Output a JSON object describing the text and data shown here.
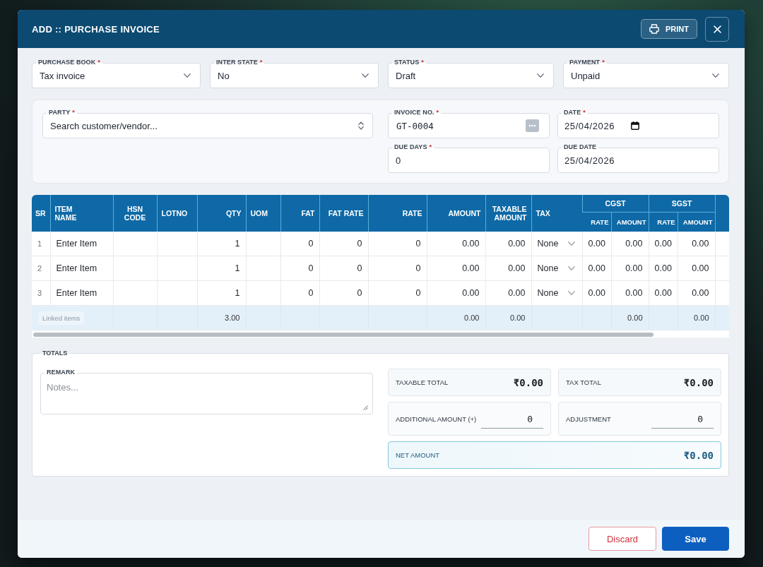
{
  "window": {
    "title": "ADD :: PURCHASE INVOICE",
    "actions": [
      {
        "kind": "print",
        "label": "PRINT"
      },
      {
        "kind": "close"
      }
    ]
  },
  "header_fields": [
    {
      "kind": "select",
      "label": "PURCHASE BOOK",
      "required_mark": "*",
      "value": "Tax invoice"
    },
    {
      "kind": "select",
      "label": "INTER STATE",
      "required_mark": "*",
      "value": "No"
    },
    {
      "kind": "select",
      "label": "STATUS",
      "required_mark": "*",
      "value": "Draft"
    },
    {
      "kind": "select",
      "label": "PAYMENT",
      "required_mark": "*",
      "value": "Unpaid"
    }
  ],
  "party_section": {
    "fields": [
      {
        "kind": "search",
        "label": "PARTY",
        "required_mark": "*",
        "placeholder": "Search customer/vendor..."
      },
      {
        "kind": "code",
        "label": "INVOICE NO.",
        "required_mark": "*",
        "value": "GT-0004"
      },
      {
        "kind": "date",
        "label": "DATE",
        "required_mark": "*",
        "value": "25/04/2026"
      },
      {
        "kind": "number",
        "label": "DUE DAYS",
        "required_mark": "*",
        "value": "0"
      },
      {
        "kind": "text",
        "label": "DUE DATE",
        "value": "25/04/2026"
      }
    ]
  },
  "items_table": {
    "columns": [
      {
        "label": "SR",
        "kind": "index"
      },
      {
        "label": "ITEM\nNAME",
        "kind": "text"
      },
      {
        "label": "HSN\nCODE",
        "kind": "code"
      },
      {
        "label": "LOTNO",
        "kind": "text"
      },
      {
        "label": "QTY",
        "kind": "number"
      },
      {
        "label": "UOM",
        "kind": "text"
      },
      {
        "label": "FAT",
        "kind": "number"
      },
      {
        "label": "FAT RATE",
        "kind": "number"
      },
      {
        "label": "RATE",
        "kind": "number"
      },
      {
        "label": "AMOUNT",
        "kind": "number"
      },
      {
        "label": "TAXABLE\nAMOUNT",
        "kind": "number"
      },
      {
        "label": "TAX",
        "kind": "select"
      },
      {
        "label": "CGST",
        "kind": "group",
        "subcolumns": [
          {
            "label": "RATE",
            "kind": "number"
          },
          {
            "label": "AMOUNT",
            "kind": "number"
          }
        ]
      },
      {
        "label": "SGST",
        "kind": "group",
        "subcolumns": [
          {
            "label": "RATE",
            "kind": "number"
          },
          {
            "label": "AMOUNT",
            "kind": "number"
          }
        ]
      }
    ],
    "rows": [
      {
        "sr": "1",
        "item_name": "Enter Item",
        "qty": "1",
        "fat": "0",
        "fat_rate": "0",
        "rate": "0",
        "amount": "0.00",
        "taxable_amount": "0.00",
        "tax": "None",
        "cgst_rate": "0.00",
        "cgst_amount": "0.00",
        "sgst_rate": "0.00",
        "sgst_amount": "0.00"
      },
      {
        "sr": "2",
        "item_name": "Enter Item",
        "qty": "1",
        "fat": "0",
        "fat_rate": "0",
        "rate": "0",
        "amount": "0.00",
        "taxable_amount": "0.00",
        "tax": "None",
        "cgst_rate": "0.00",
        "cgst_amount": "0.00",
        "sgst_rate": "0.00",
        "sgst_amount": "0.00"
      },
      {
        "sr": "3",
        "item_name": "Enter Item",
        "qty": "1",
        "fat": "0",
        "fat_rate": "0",
        "rate": "0",
        "amount": "0.00",
        "taxable_amount": "0.00",
        "tax": "None",
        "cgst_rate": "0.00",
        "cgst_amount": "0.00",
        "sgst_rate": "0.00",
        "sgst_amount": "0.00"
      }
    ],
    "footer": {
      "linked_items": "Linked items",
      "qty": "3.00",
      "amount": "0.00",
      "taxable_amount": "0.00",
      "cgst_amount": "0.00",
      "sgst_amount": "0.00"
    }
  },
  "totals": {
    "title": "TOTALS",
    "remark": {
      "label": "REMARK",
      "placeholder": "Notes..."
    },
    "summary": [
      {
        "kind": "display",
        "label": "TAXABLE TOTAL",
        "value": "₹0.00"
      },
      {
        "kind": "display",
        "label": "TAX TOTAL",
        "value": "₹0.00"
      },
      {
        "kind": "input",
        "label": "ADDITIONAL AMOUNT (+)",
        "value": "0"
      },
      {
        "kind": "input",
        "label": "ADJUSTMENT",
        "value": "0"
      },
      {
        "kind": "net",
        "label": "NET AMOUNT",
        "value": "₹0.00"
      }
    ]
  },
  "footer_buttons": [
    {
      "kind": "outline",
      "label": "Discard"
    },
    {
      "kind": "primary",
      "label": "Save"
    }
  ]
}
